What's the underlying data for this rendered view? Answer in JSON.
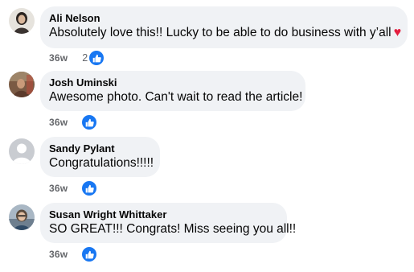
{
  "comments": [
    {
      "author": "Ali Nelson",
      "text": "Absolutely love this!! Lucky to be able to do business with y’all",
      "time": "36w",
      "reaction_count": "2",
      "heart": "♥"
    },
    {
      "author": "Josh Uminski",
      "text": "Awesome photo. Can't wait to read the article!",
      "time": "36w"
    },
    {
      "author": "Sandy Pylant",
      "text": "Congratulations!!!!!",
      "time": "36w"
    },
    {
      "author": "Susan Wright Whittaker",
      "text": "SO GREAT!!! Congrats! Miss seeing you all!!",
      "time": "36w"
    }
  ],
  "colors": {
    "bubble": "#f0f2f5",
    "meta_text": "#65676b",
    "like_blue": "#1877f2",
    "heart_red": "#e41e3f"
  },
  "icons": {
    "reaction": "thumbs-up-icon",
    "emoji": "red-heart-emoji"
  }
}
